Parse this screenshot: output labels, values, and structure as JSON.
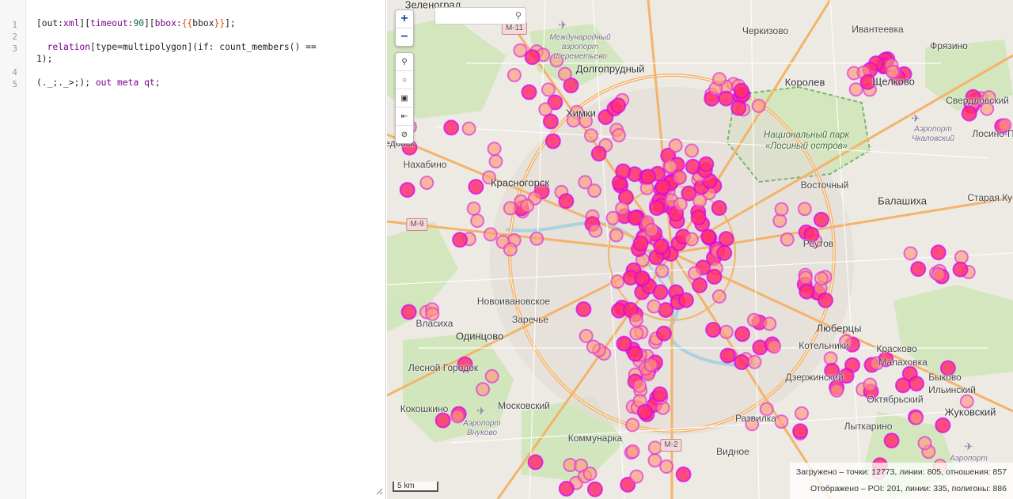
{
  "editor": {
    "line_numbers": [
      "1",
      "2",
      "3",
      "4",
      "5"
    ],
    "lines": [
      {
        "tokens": [
          {
            "t": "[out:"
          },
          {
            "t": "xml",
            "c": "kw"
          },
          {
            "t": "]["
          },
          {
            "t": "timeout:",
            "c": "kw"
          },
          {
            "t": "90",
            "c": "num"
          },
          {
            "t": "]["
          },
          {
            "t": "bbox:",
            "c": "kw"
          },
          {
            "t": "{{",
            "c": "tpl"
          },
          {
            "t": "bbox"
          },
          {
            "t": "}}",
            "c": "tpl"
          },
          {
            "t": "];"
          }
        ]
      },
      {
        "tokens": []
      },
      {
        "tokens": [
          {
            "t": "  "
          },
          {
            "t": "relation",
            "c": "kw"
          },
          {
            "t": "[type=multipolygon](if: count_members() =="
          }
        ]
      },
      {
        "tokens": [
          {
            "t": "1);"
          }
        ]
      },
      {
        "tokens": []
      },
      {
        "tokens": [
          {
            "t": "(._;._>;); "
          },
          {
            "t": "out",
            "c": "kw"
          },
          {
            "t": " "
          },
          {
            "t": "meta",
            "c": "kw"
          },
          {
            "t": " "
          },
          {
            "t": "qt",
            "c": "kw"
          },
          {
            "t": ";"
          }
        ]
      }
    ]
  },
  "map": {
    "zoom_in": "+",
    "zoom_out": "−",
    "search": {
      "value": "",
      "placeholder": ""
    },
    "tools": [
      {
        "name": "search-tool-icon",
        "glyph": "⚲"
      },
      {
        "name": "locate-icon",
        "glyph": "○"
      },
      {
        "name": "image-export-icon",
        "glyph": "▣"
      },
      {
        "name": "fit-data-icon",
        "glyph": "⇤"
      },
      {
        "name": "clear-data-icon",
        "glyph": "⊘"
      }
    ],
    "scale_label": "5 km",
    "stats": {
      "loaded": "Загружено – точки: 12773, линии: 805, отношения: 857",
      "displayed": "Отображено – POI: 201, линии: 335, полигоны: 886"
    },
    "places": [
      {
        "name": "Зеленоград",
        "cls": "big"
      },
      {
        "name": "Черкизово",
        "cls": ""
      },
      {
        "name": "Ивантеевка",
        "cls": ""
      },
      {
        "name": "Фрязино",
        "cls": ""
      },
      {
        "name": "Долгопрудный",
        "cls": "big"
      },
      {
        "name": "Королев",
        "cls": "big"
      },
      {
        "name": "Щелково",
        "cls": "big"
      },
      {
        "name": "Свердловский",
        "cls": ""
      },
      {
        "name": "Химки",
        "cls": "big"
      },
      {
        "name": "Лосино-П",
        "cls": ""
      },
      {
        "name": "Нахабино",
        "cls": ""
      },
      {
        "name": "Красногорск",
        "cls": "big"
      },
      {
        "name": "Восточный",
        "cls": ""
      },
      {
        "name": "Балашиха",
        "cls": "big"
      },
      {
        "name": "Старая Куп",
        "cls": ""
      },
      {
        "name": "Реутов",
        "cls": ""
      },
      {
        "name": "Новоивановское",
        "cls": ""
      },
      {
        "name": "Заречье",
        "cls": ""
      },
      {
        "name": "Власиха",
        "cls": ""
      },
      {
        "name": "Одинцово",
        "cls": "big"
      },
      {
        "name": "Люберцы",
        "cls": "big"
      },
      {
        "name": "Котельники",
        "cls": ""
      },
      {
        "name": "Красково",
        "cls": ""
      },
      {
        "name": "Малаховка",
        "cls": ""
      },
      {
        "name": "Лесной Городок",
        "cls": ""
      },
      {
        "name": "Дзержинский",
        "cls": ""
      },
      {
        "name": "Быково",
        "cls": ""
      },
      {
        "name": "Ильинский",
        "cls": ""
      },
      {
        "name": "Кокошкино",
        "cls": ""
      },
      {
        "name": "Московский",
        "cls": ""
      },
      {
        "name": "Октябрьский",
        "cls": ""
      },
      {
        "name": "Жуковский",
        "cls": "big"
      },
      {
        "name": "Развилка",
        "cls": ""
      },
      {
        "name": "Лыткарино",
        "cls": ""
      },
      {
        "name": "Коммунарка",
        "cls": ""
      },
      {
        "name": "Видное",
        "cls": ""
      },
      {
        "name": "Дедовск",
        "cls": ""
      },
      {
        "name": "Международный аэропорт Шереметьево",
        "cls": "it"
      },
      {
        "name": "Аэропорт Чкаловский",
        "cls": "it"
      },
      {
        "name": "Аэропорт Внуково",
        "cls": "it"
      },
      {
        "name": "Аэропорт",
        "cls": "it"
      }
    ],
    "park_label": "Национальный парк «Лосиный остров»",
    "shields": [
      "M-11",
      "M-9",
      "M-2"
    ],
    "colors": {
      "marker_fill": "#ff2f6e",
      "marker_stroke": "#d000ff",
      "poly_fill": "#ff9a7a",
      "road_major": "#f3b36b",
      "road_minor": "#ffffff",
      "park": "#cfe6b8",
      "water": "#aad3df"
    }
  }
}
